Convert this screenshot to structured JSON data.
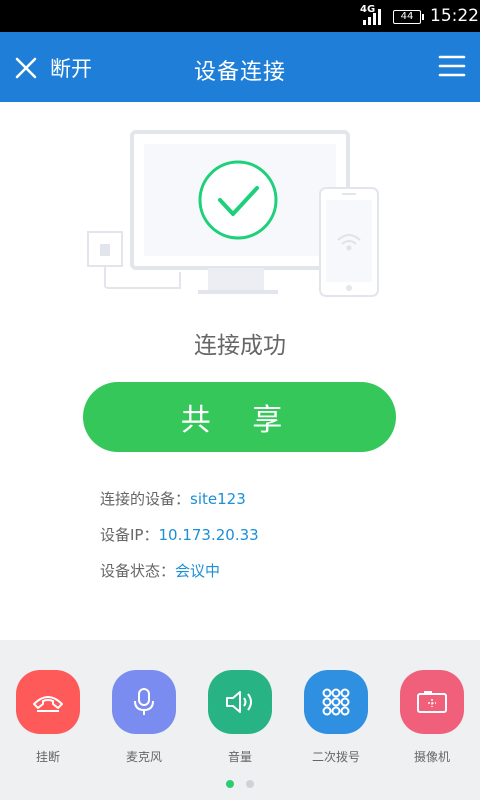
{
  "status_bar": {
    "network": "4G",
    "battery": "44",
    "time": "15:22"
  },
  "app_bar": {
    "close_label": "断开",
    "title": "设备连接"
  },
  "main": {
    "status": "连接成功",
    "share_label": "共 享",
    "device_label": "连接的设备：",
    "device_value": "site123",
    "ip_label": "设备IP：",
    "ip_value": "10.173.20.33",
    "state_label": "设备状态：",
    "state_value": "会议中"
  },
  "actions": [
    {
      "label": "挂断",
      "icon": "hangup-icon",
      "color": "#ff5a5a"
    },
    {
      "label": "麦克风",
      "icon": "microphone-icon",
      "color": "#7b8cf0"
    },
    {
      "label": "音量",
      "icon": "volume-icon",
      "color": "#27b383"
    },
    {
      "label": "二次拨号",
      "icon": "dialpad-icon",
      "color": "#2f8fe0"
    },
    {
      "label": "摄像机",
      "icon": "camera-icon",
      "color": "#f0607a"
    }
  ],
  "pager": {
    "active_index": 0,
    "count": 2,
    "active_color": "#2ecc71",
    "inactive_color": "#cfd3d8"
  }
}
